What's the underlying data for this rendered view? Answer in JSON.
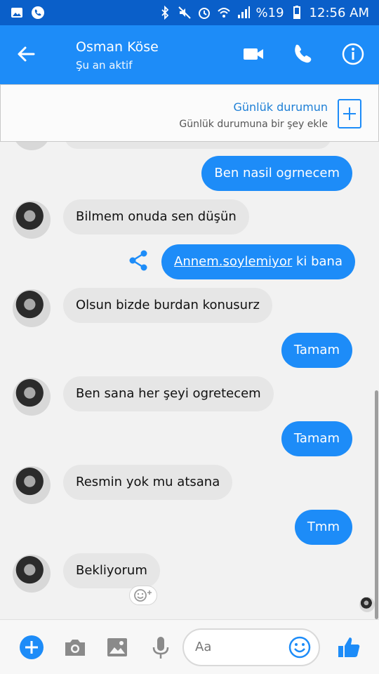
{
  "status_bar": {
    "battery": "%19",
    "time": "12:56 AM"
  },
  "header": {
    "contact_name": "Osman Köse",
    "contact_status": "Şu an aktif"
  },
  "story": {
    "title": "Günlük durumun",
    "subtitle": "Günlük durumuna bir şey ekle"
  },
  "messages": [
    {
      "dir": "out",
      "text": "Ben nasil ogrnecem"
    },
    {
      "dir": "in",
      "text": "Bilmem onuda sen düşün"
    },
    {
      "dir": "out",
      "text_link": "Annem.soylemiyor",
      "text_rest": " ki bana"
    },
    {
      "dir": "in",
      "text": "Olsun bizde burdan konusurz"
    },
    {
      "dir": "out",
      "text": "Tamam"
    },
    {
      "dir": "in",
      "text": "Ben sana her şeyi ogretecem"
    },
    {
      "dir": "out",
      "text": "Tamam"
    },
    {
      "dir": "in",
      "text": "Resmin yok mu atsana"
    },
    {
      "dir": "out",
      "text": "Tmm"
    },
    {
      "dir": "in",
      "text": "Bekliyorum"
    }
  ],
  "composer": {
    "placeholder": "Aa"
  },
  "colors": {
    "accent": "#1d8cf8",
    "statusbar": "#0a5fc9",
    "incoming_bubble": "#e6e6e6"
  }
}
